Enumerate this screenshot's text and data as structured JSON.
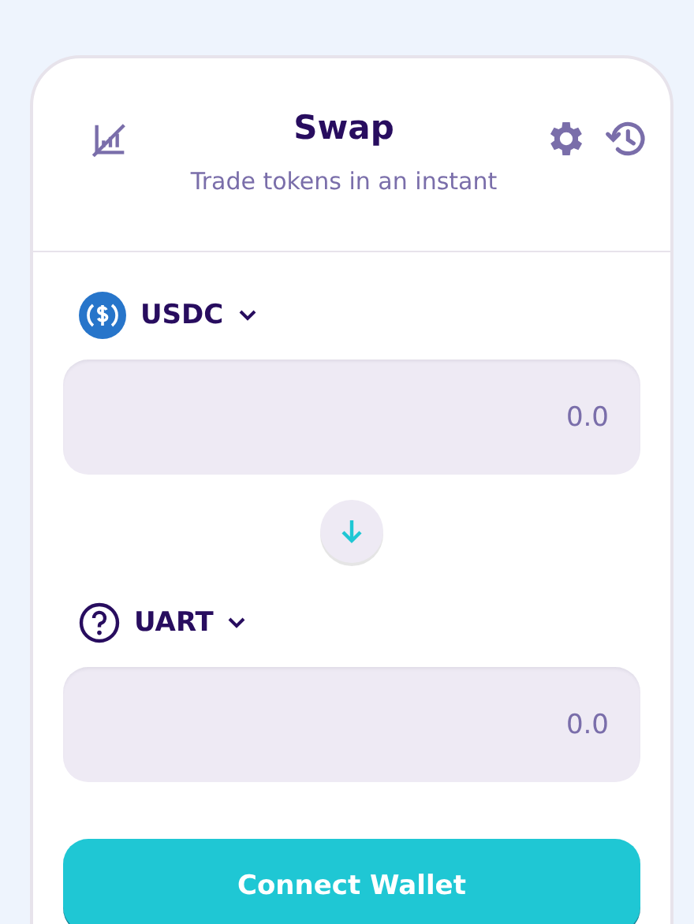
{
  "header": {
    "title": "Swap",
    "subtitle": "Trade tokens in an instant"
  },
  "tokens": [
    {
      "kind": "usdc",
      "symbol": "USDC",
      "placeholder": "0.0"
    },
    {
      "kind": "unknown",
      "symbol": "UART",
      "placeholder": "0.0"
    }
  ],
  "action_button": "Connect Wallet"
}
